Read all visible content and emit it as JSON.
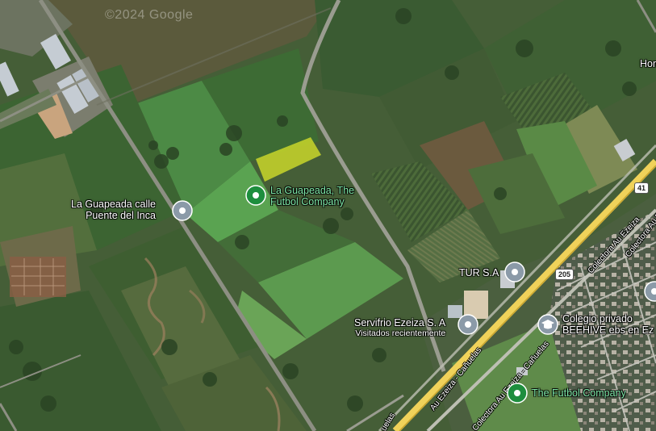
{
  "watermark": "©2024 Google",
  "places": [
    {
      "id": "guapeada-calle",
      "line1": "La Guapeada calle",
      "line2": "Puente del Inca",
      "pin_color": "#8b9aa8",
      "text_color": "white"
    },
    {
      "id": "guapeada-futbol",
      "line1": "La Guapeada, The",
      "line2": "Futbol Company",
      "pin_color": "#1e8e3e",
      "text_color": "green"
    },
    {
      "id": "tur",
      "line1": "TUR S.A",
      "pin_color": "#8b9aa8",
      "text_color": "white"
    },
    {
      "id": "servifrio",
      "line1": "Servifrio Ezeiza S. A",
      "sub": "Visitados recientemente",
      "pin_color": "#8b9aa8",
      "text_color": "white"
    },
    {
      "id": "colegio",
      "line1": "Colegio privado",
      "line2": "BEEHIVE ebs en Ez",
      "pin_color": "#8b9aa8",
      "icon": "school-icon",
      "text_color": "white"
    },
    {
      "id": "futbol-company",
      "line1": "The Futbol Company",
      "pin_color": "#1e8e3e",
      "text_color": "green"
    },
    {
      "id": "hom",
      "line1": "Hom",
      "text_color": "white"
    }
  ],
  "roads": {
    "ezeiza_canuelas_1": "Au Ezeiza - Cañuelas",
    "ezeiza_canuelas_2": "Colectora Au Ezeiza - Cañuelas",
    "colectora_top": "Colectora Au Ezeiza",
    "colectora_upper": "Colectora Au Ezeiza",
    "bottom_fragment": "uelas",
    "route_205": "205",
    "route_41": "41"
  }
}
